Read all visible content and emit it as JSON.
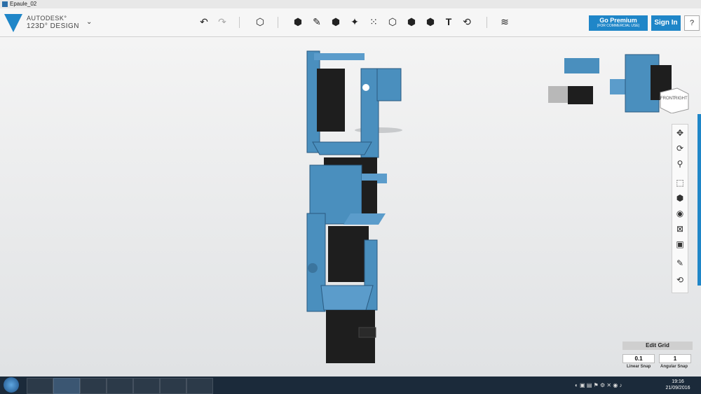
{
  "window": {
    "title": "Epaule_02"
  },
  "brand": {
    "line1": "AUTODESK°",
    "line2": "123D° DESIGN"
  },
  "toolbar": {
    "icons": [
      "undo-icon",
      "redo-icon",
      "primitives-icon",
      "sketch-icon",
      "construct-icon",
      "modify-icon",
      "pattern-icon",
      "group-icon",
      "combine-icon",
      "measure-icon",
      "text-icon",
      "snap-icon",
      "material-icon"
    ]
  },
  "actions": {
    "premium_label": "Go Premium",
    "premium_sub": "(FOR COMMERCIAL USE)",
    "signin_label": "Sign In",
    "help_label": "?"
  },
  "viewcube": {
    "front": "FRONT",
    "right": "RIGHT"
  },
  "grid": {
    "title": "Edit Grid",
    "linear_value": "0.1",
    "angular_value": "1",
    "linear_label": "Linear Snap",
    "angular_label": "Angular Snap"
  },
  "taskbar": {
    "time": "19:16",
    "date": "21/09/2016"
  },
  "colors": {
    "accent": "#1f86c8",
    "part_blue": "#4a8fbe",
    "servo_black": "#1e1e1e"
  }
}
